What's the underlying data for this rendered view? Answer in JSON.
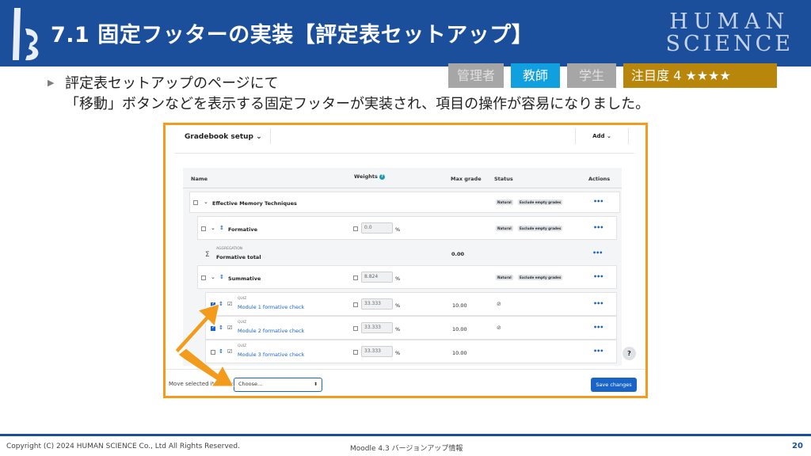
{
  "header": {
    "title": "7.1 固定フッターの実装【評定表セットアップ】",
    "brand_line1": "HUMAN",
    "brand_line2": "SCIENCE"
  },
  "tags": {
    "admin": "管理者",
    "teacher": "教師",
    "student": "学生",
    "attention": "注目度 4 ★★★★"
  },
  "bullet": {
    "line1": "評定表セットアップのページにて",
    "line2": "「移動」ボタンなどを表示する固定フッターが実装され、項目の操作が容易になりました。"
  },
  "screenshot": {
    "gradebook_title": "Gradebook setup ⌄",
    "add_label": "Add ⌄",
    "columns": {
      "name": "Name",
      "weights": "Weights",
      "max_grade": "Max grade",
      "status": "Status",
      "actions": "Actions"
    },
    "rows": {
      "category": {
        "name": "Effective Memory Techniques",
        "badge1": "Natural",
        "badge2": "Exclude empty grades"
      },
      "formative": {
        "name": "Formative",
        "weight": "0.0",
        "pct": "%",
        "badge1": "Natural",
        "badge2": "Exclude empty grades"
      },
      "formative_total": {
        "small": "AGGREGATION",
        "name": "Formative total",
        "max": "0.00"
      },
      "summative": {
        "name": "Summative",
        "weight": "8.824",
        "pct": "%",
        "badge1": "Natural",
        "badge2": "Exclude empty grades"
      },
      "quiz1": {
        "small": "QUIZ",
        "name": "Module 1 formative check",
        "weight": "33.333",
        "pct": "%",
        "max": "10.00"
      },
      "quiz2": {
        "small": "QUIZ",
        "name": "Module 2 formative check",
        "weight": "33.333",
        "pct": "%",
        "max": "10.00"
      },
      "quiz3": {
        "small": "QUIZ",
        "name": "Module 3 formative check",
        "weight": "33.333",
        "pct": "%",
        "max": "10.00"
      }
    },
    "dots": "•••",
    "help": "?",
    "footer": {
      "move_label": "Move selected items to",
      "select_value": "Choose...",
      "save_label": "Save changes"
    }
  },
  "footer": {
    "copyright": "Copyright (C) 2024 HUMAN SCIENCE Co., Ltd All Rights Reserved.",
    "subject": "Moodle 4.3 バージョンアップ情報",
    "page": "20"
  },
  "colors": {
    "header_blue": "#1c4f9b",
    "frame_orange": "#f39b1d",
    "teacher_blue": "#10a0e0",
    "attention_gold": "#b8860b",
    "inactive_gray": "#a6a6a6"
  }
}
